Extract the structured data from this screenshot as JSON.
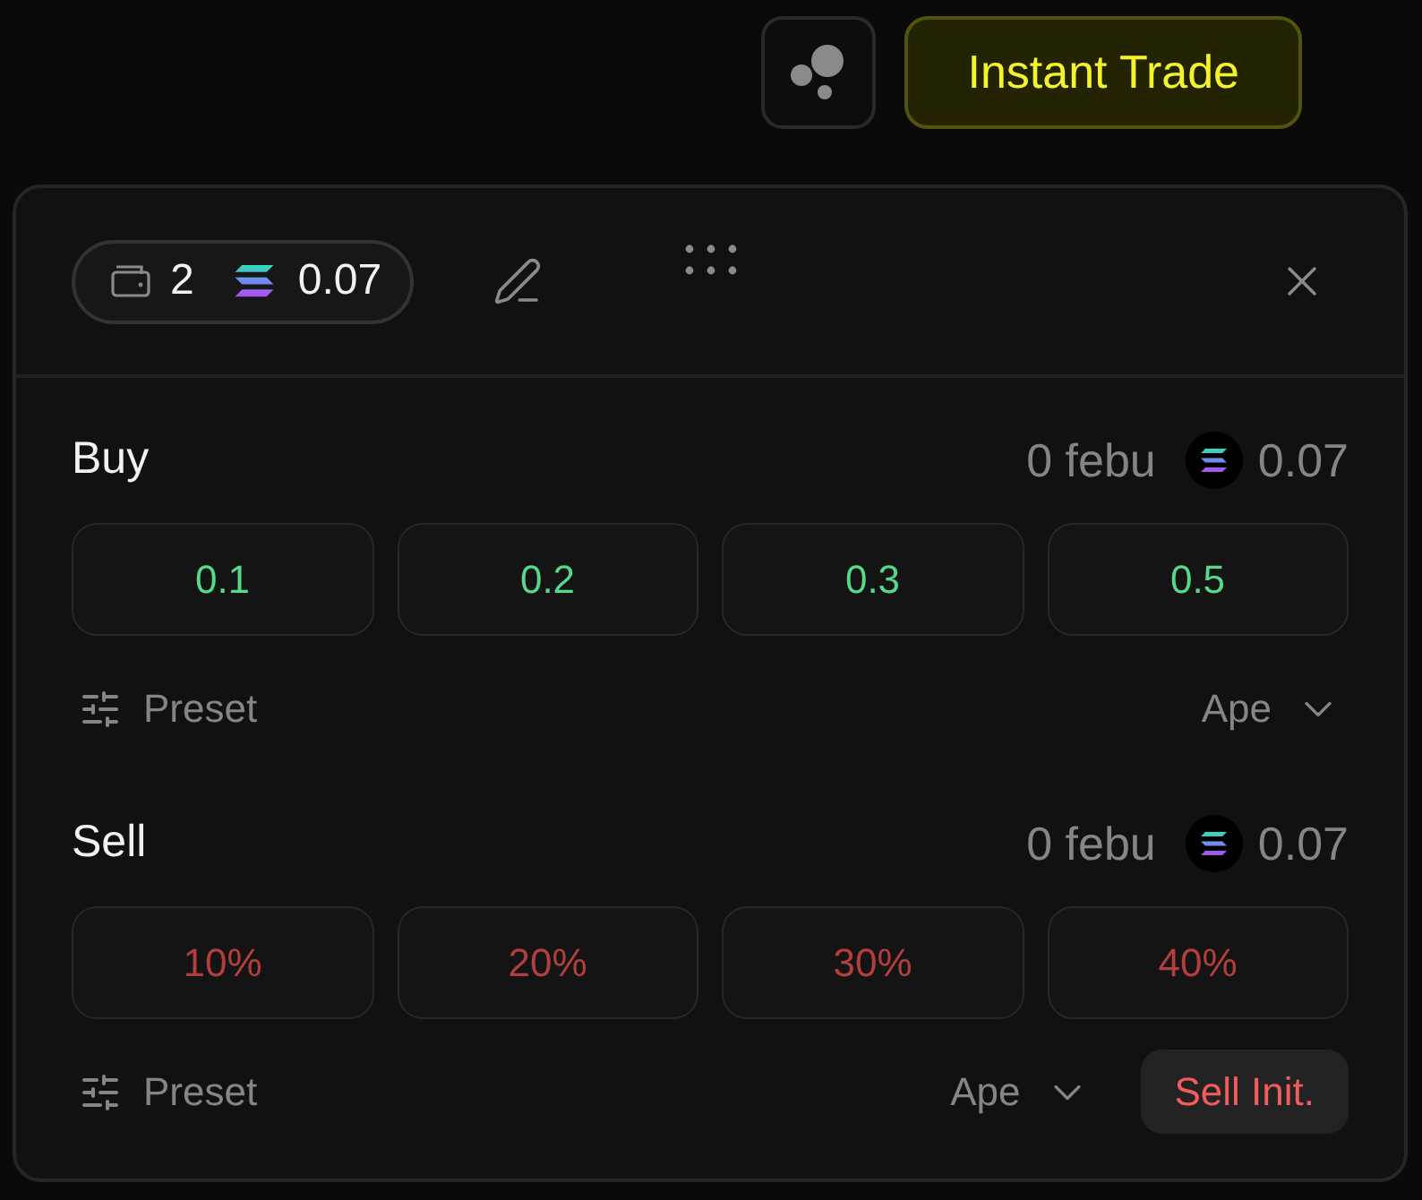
{
  "toolbar": {
    "trade_button": "Instant Trade"
  },
  "panel": {
    "header": {
      "wallet_count": "2",
      "sol_balance": "0.07"
    },
    "sections": [
      {
        "kind": "buy",
        "title": "Buy",
        "token_balance": "0 febu",
        "sol_balance": "0.07",
        "amounts": [
          "0.1",
          "0.2",
          "0.3",
          "0.5"
        ],
        "preset": "Preset",
        "mode": "Ape"
      },
      {
        "kind": "sell",
        "title": "Sell",
        "token_balance": "0 febu",
        "sol_balance": "0.07",
        "amounts": [
          "10%",
          "20%",
          "30%",
          "40%"
        ],
        "preset": "Preset",
        "mode": "Ape",
        "action": "Sell Init."
      }
    ]
  }
}
